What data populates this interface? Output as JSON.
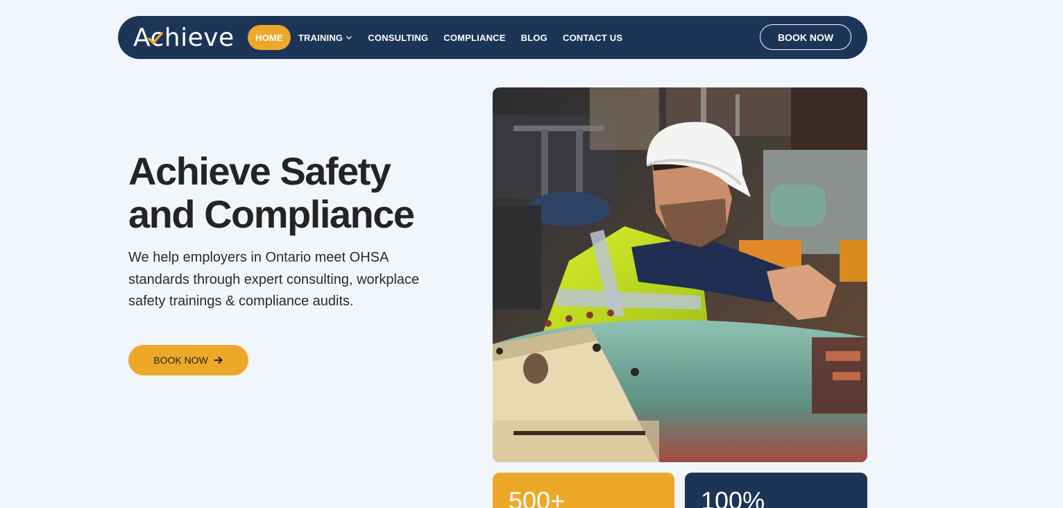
{
  "brand": {
    "logo_text": "Achieve",
    "accent": "#eda82a",
    "navy": "#1c3557"
  },
  "nav": {
    "items": [
      {
        "label": "HOME",
        "active": true
      },
      {
        "label": "TRAINING",
        "dropdown": true
      },
      {
        "label": "CONSULTING"
      },
      {
        "label": "COMPLIANCE"
      },
      {
        "label": "BLOG"
      },
      {
        "label": "CONTACT US"
      }
    ],
    "book_label": "BOOK NOW"
  },
  "hero": {
    "title_line1": "Achieve Safety",
    "title_line2": "and Compliance",
    "description": "We help employers in Ontario meet OHSA standards through expert consulting, workplace safety trainings & compliance audits.",
    "cta_label": "BOOK NOW",
    "image_icon": "worker-photo"
  },
  "stats": [
    {
      "value": "500+"
    },
    {
      "value": "100%"
    }
  ]
}
